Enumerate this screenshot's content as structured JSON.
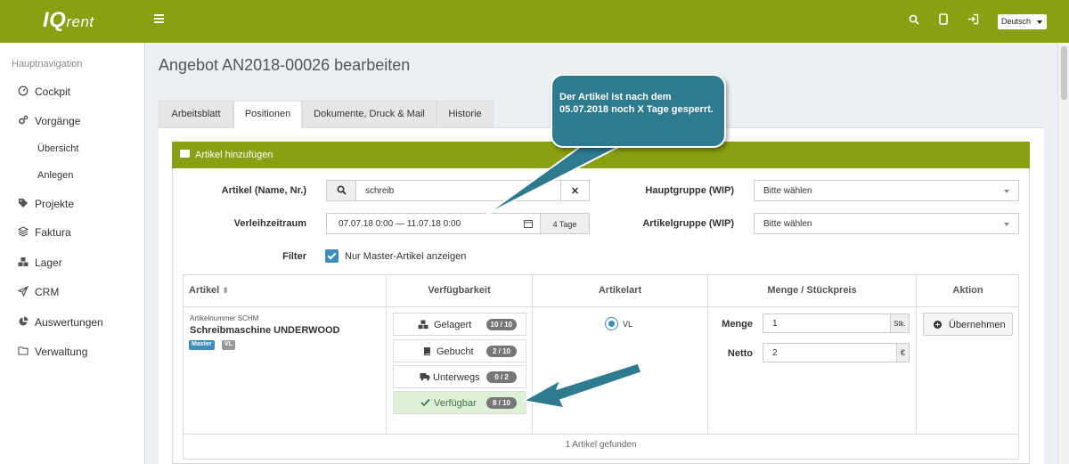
{
  "header": {
    "logo_main": "IQ",
    "logo_sub": "rent",
    "language": "Deutsch"
  },
  "sidebar": {
    "title": "Hauptnavigation",
    "items": [
      {
        "label": "Cockpit",
        "icon": "dashboard-icon"
      },
      {
        "label": "Vorgänge",
        "icon": "cogs-icon"
      },
      {
        "label": "Übersicht"
      },
      {
        "label": "Anlegen"
      },
      {
        "label": "Projekte",
        "icon": "tag-icon"
      },
      {
        "label": "Faktura",
        "icon": "layers-icon"
      },
      {
        "label": "Lager",
        "icon": "cubes-icon"
      },
      {
        "label": "CRM",
        "icon": "paper-plane-icon"
      },
      {
        "label": "Auswertungen",
        "icon": "pie-chart-icon"
      },
      {
        "label": "Verwaltung",
        "icon": "folder-icon"
      }
    ]
  },
  "page": {
    "title": "Angebot AN2018-00026 bearbeiten",
    "tabs": [
      "Arbeitsblatt",
      "Positionen",
      "Dokumente, Druck & Mail",
      "Historie"
    ],
    "active_tab": "Positionen"
  },
  "box": {
    "title": "Artikel hinzufügen"
  },
  "form": {
    "article_label": "Artikel (Name, Nr.)",
    "article_value": "schreib",
    "period_label": "Verleihzeitraum",
    "period_value": "07.07.18 0:00 — 11.07.18 0:00",
    "period_days": "4 Tage",
    "filter_label": "Filter",
    "filter_checkbox": "Nur Master-Artikel anzeigen",
    "main_group_label": "Hauptgruppe (WIP)",
    "main_group_value": "Bitte wählen",
    "article_group_label": "Artikelgruppe (WIP)",
    "article_group_value": "Bitte wählen"
  },
  "table": {
    "headers": [
      "Artikel",
      "Verfügbarkeit",
      "Artikelart",
      "Menge / Stückpreis",
      "Aktion"
    ],
    "row": {
      "article_no": "Artikelnummer SCHM",
      "article_name": "Schreibmaschine UNDERWOOD",
      "badges": [
        "Master",
        "VL"
      ],
      "availability": [
        {
          "label": "Gelagert",
          "count": "10 / 10",
          "icon": "cubes-icon"
        },
        {
          "label": "Gebucht",
          "count": "2 / 10",
          "icon": "book-icon"
        },
        {
          "label": "Unterwegs",
          "count": "0 / 2",
          "icon": "truck-icon"
        },
        {
          "label": "Verfügbar",
          "count": "8 / 10",
          "icon": "check-icon"
        }
      ],
      "article_type": "VL",
      "quantity_label": "Menge",
      "quantity_value": "1",
      "quantity_unit": "Stk.",
      "net_label": "Netto",
      "net_value": "2",
      "net_unit": "€",
      "action": "Übernehmen"
    },
    "footer": "1 Artikel gefunden"
  },
  "callout": {
    "text": "Der Artikel ist nach dem 05.07.2018 noch X Tage gesperrt."
  },
  "colors": {
    "brand": "#8a9f11",
    "callout": "#2e7a8f",
    "primary": "#3c8dbc",
    "success_bg": "#dff0d8"
  }
}
